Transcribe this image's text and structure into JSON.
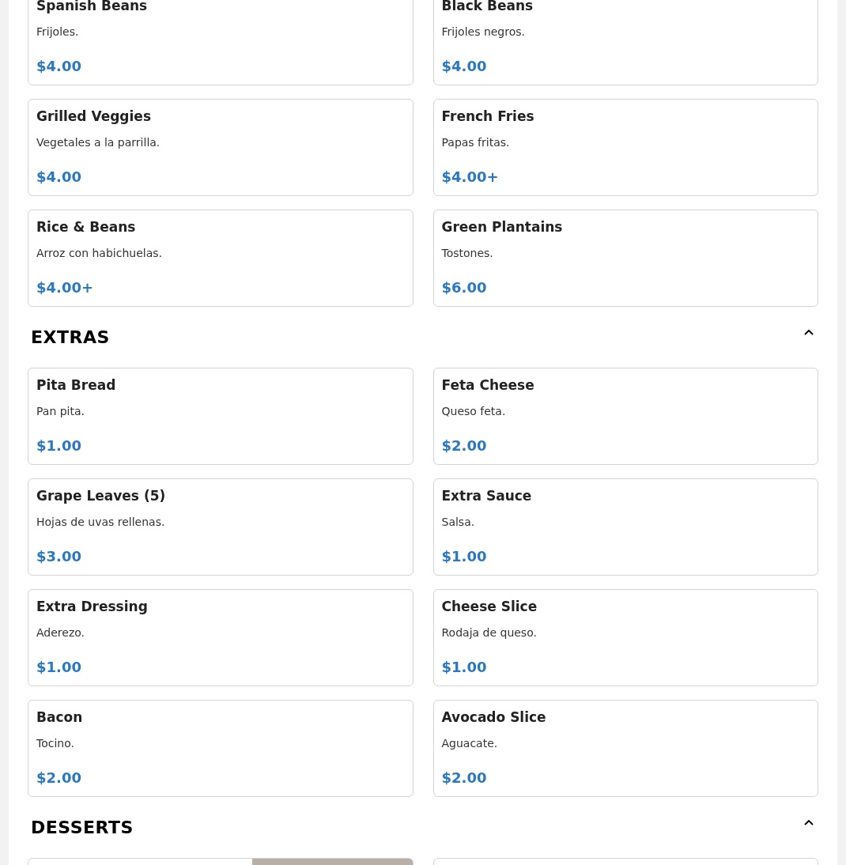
{
  "sections": [
    {
      "items": [
        {
          "name": "Spanish Beans",
          "description": "Frijoles.",
          "price": "$4.00"
        },
        {
          "name": "Black Beans",
          "description": "Frijoles negros.",
          "price": "$4.00"
        },
        {
          "name": "Grilled Veggies",
          "description": "Vegetales a la parrilla.",
          "price": "$4.00"
        },
        {
          "name": "French Fries",
          "description": "Papas fritas.",
          "price": "$4.00+"
        },
        {
          "name": "Rice & Beans",
          "description": "Arroz con habichuelas.",
          "price": "$4.00+"
        },
        {
          "name": "Green Plantains",
          "description": "Tostones.",
          "price": "$6.00"
        }
      ]
    },
    {
      "title": "EXTRAS",
      "expanded": true,
      "items": [
        {
          "name": "Pita Bread",
          "description": "Pan pita.",
          "price": "$1.00"
        },
        {
          "name": "Feta Cheese",
          "description": "Queso feta.",
          "price": "$2.00"
        },
        {
          "name": "Grape Leaves (5)",
          "description": "Hojas de uvas rellenas.",
          "price": "$3.00"
        },
        {
          "name": "Extra Sauce",
          "description": "Salsa.",
          "price": "$1.00"
        },
        {
          "name": "Extra Dressing",
          "description": "Aderezo.",
          "price": "$1.00"
        },
        {
          "name": "Cheese Slice",
          "description": "Rodaja de queso.",
          "price": "$1.00"
        },
        {
          "name": "Bacon",
          "description": "Tocino.",
          "price": "$2.00"
        },
        {
          "name": "Avocado Slice",
          "description": "Aguacate.",
          "price": "$2.00"
        }
      ]
    },
    {
      "title": "DESSERTS",
      "expanded": true,
      "items": [
        {
          "photo": true
        },
        {
          "photo": false
        }
      ]
    }
  ]
}
